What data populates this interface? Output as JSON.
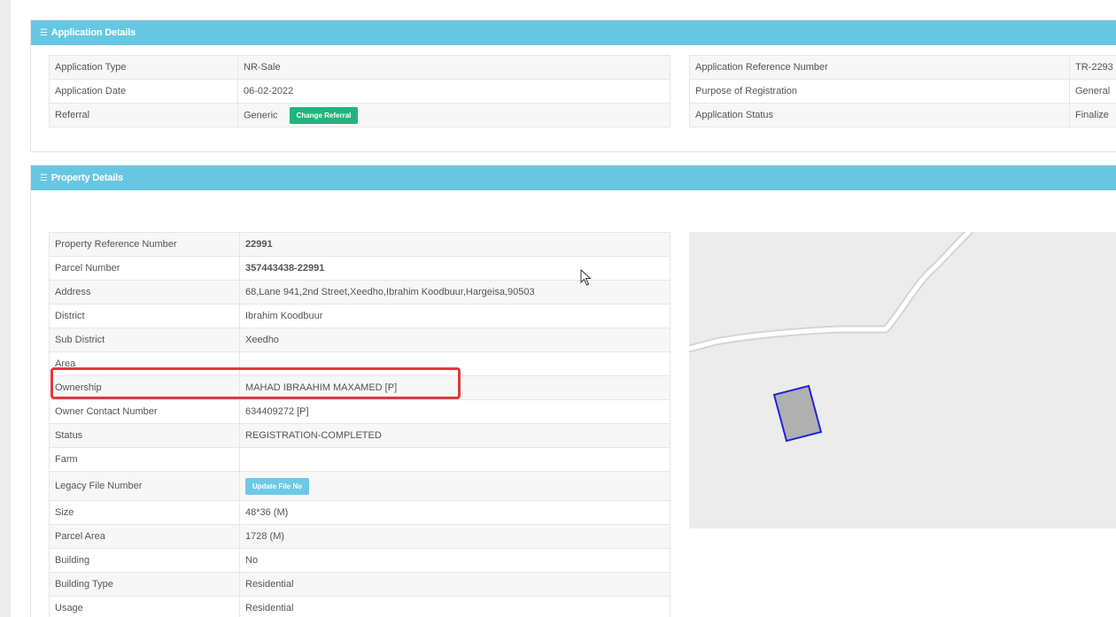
{
  "application_details": {
    "title": "Application Details",
    "left_rows": [
      {
        "label": "Application Type",
        "value": "NR-Sale"
      },
      {
        "label": "Application Date",
        "value": "06-02-2022"
      },
      {
        "label": "Referral",
        "value": "Generic",
        "button": "Change Referral"
      }
    ],
    "right_rows": [
      {
        "label": "Application Reference Number",
        "value": "TR-2293"
      },
      {
        "label": "Purpose of Registration",
        "value": "General"
      },
      {
        "label": "Application Status",
        "value": "Finalize"
      }
    ]
  },
  "property_details": {
    "title": "Property Details",
    "rows": [
      {
        "label": "Property Reference Number",
        "value": "22991"
      },
      {
        "label": "Parcel Number",
        "value": "357443438-22991"
      },
      {
        "label": "Address",
        "value": "68,Lane 941,2nd Street,Xeedho,Ibrahim Koodbuur,Hargeisa,90503"
      },
      {
        "label": "District",
        "value": "Ibrahim Koodbuur"
      },
      {
        "label": "Sub District",
        "value": "Xeedho"
      },
      {
        "label": "Area",
        "value": ""
      },
      {
        "label": "Ownership",
        "value": "MAHAD IBRAAHIM MAXAMED [P]"
      },
      {
        "label": "Owner Contact Number",
        "value": "634409272 [P]"
      },
      {
        "label": "Status",
        "value": "REGISTRATION-COMPLETED"
      },
      {
        "label": "Farm",
        "value": ""
      },
      {
        "label": "Legacy File Number",
        "value": "",
        "button": "Update File No"
      },
      {
        "label": "Size",
        "value": "48*36 (M)"
      },
      {
        "label": "Parcel Area",
        "value": "1728 (M)"
      },
      {
        "label": "Building",
        "value": "No"
      },
      {
        "label": "Building Type",
        "value": "Residential"
      },
      {
        "label": "Usage",
        "value": "Residential"
      }
    ]
  },
  "colors": {
    "panel_header": "#67c7e2",
    "green_button": "#1fb57a",
    "blue_button": "#6ec9e6",
    "highlight": "#e0393e",
    "parcel_stroke": "#2222dd",
    "parcel_fill": "#b0b0b0"
  }
}
